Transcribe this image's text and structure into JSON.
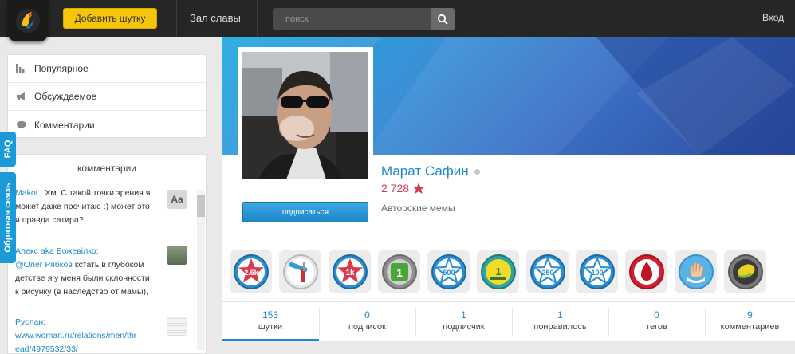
{
  "topbar": {
    "add_button": "Добавить шутку",
    "hall_of_fame": "Зал славы",
    "search_placeholder": "поиск",
    "login": "Вход"
  },
  "nav": {
    "items": [
      {
        "label": "Популярное",
        "icon": "bar-chart-icon"
      },
      {
        "label": "Обсуждаемое",
        "icon": "megaphone-icon"
      },
      {
        "label": "Комментарии",
        "icon": "speech-bubble-icon"
      }
    ]
  },
  "side_tabs": {
    "faq": "FAQ",
    "feedback": "Обратная связь"
  },
  "comments_panel": {
    "title": "комментарии",
    "items": [
      {
        "author": "MakoL:",
        "lines": [
          "Хм. С такой точки зрения я",
          "может даже прочитаю :) может это",
          "и правда сатира?"
        ],
        "thumb": "Aa"
      },
      {
        "author": "Алекс aka Божевілко:",
        "lines_mention": "@Олег Рябков",
        "lines": [
          " кстать в глубоком",
          "детстве я у меня были склонности",
          "к рисунку (в наследство от мамы),"
        ]
      },
      {
        "author": "Руслан:",
        "link_lines": [
          "www.woman.ru/relations/men/thr",
          "ead/4979532/33/"
        ]
      }
    ]
  },
  "profile": {
    "name": "Марат Сафин",
    "rating": "2 728",
    "bio": "Авторские мемы",
    "subscribe": "подписаться"
  },
  "badges": [
    {
      "label": "2.5k",
      "icon": "star-2-5k-badge-icon"
    },
    {
      "label": "",
      "icon": "broom-badge-icon"
    },
    {
      "label": "1k",
      "icon": "star-1k-badge-icon"
    },
    {
      "label": "1",
      "icon": "green-square-1-badge-icon"
    },
    {
      "label": "500",
      "icon": "star-500-badge-icon"
    },
    {
      "label": "1",
      "icon": "yellow-circle-1-badge-icon"
    },
    {
      "label": "250",
      "icon": "star-250-badge-icon"
    },
    {
      "label": "100",
      "icon": "star-100-badge-icon"
    },
    {
      "label": "",
      "icon": "blood-drop-badge-icon"
    },
    {
      "label": "",
      "icon": "hand-badge-icon"
    },
    {
      "label": "",
      "icon": "lemon-badge-icon"
    }
  ],
  "stats": [
    {
      "num": "153",
      "label": "шутки"
    },
    {
      "num": "0",
      "label": "подписок"
    },
    {
      "num": "1",
      "label": "подписчик"
    },
    {
      "num": "1",
      "label": "понравилось"
    },
    {
      "num": "0",
      "label": "тегов"
    },
    {
      "num": "9",
      "label": "комментариев"
    }
  ],
  "colors": {
    "accent": "#1e88c8",
    "topbar": "#262626",
    "add_button": "#f6c60d",
    "rating": "#d33a5a",
    "side_tab": "#1a9bd7"
  }
}
